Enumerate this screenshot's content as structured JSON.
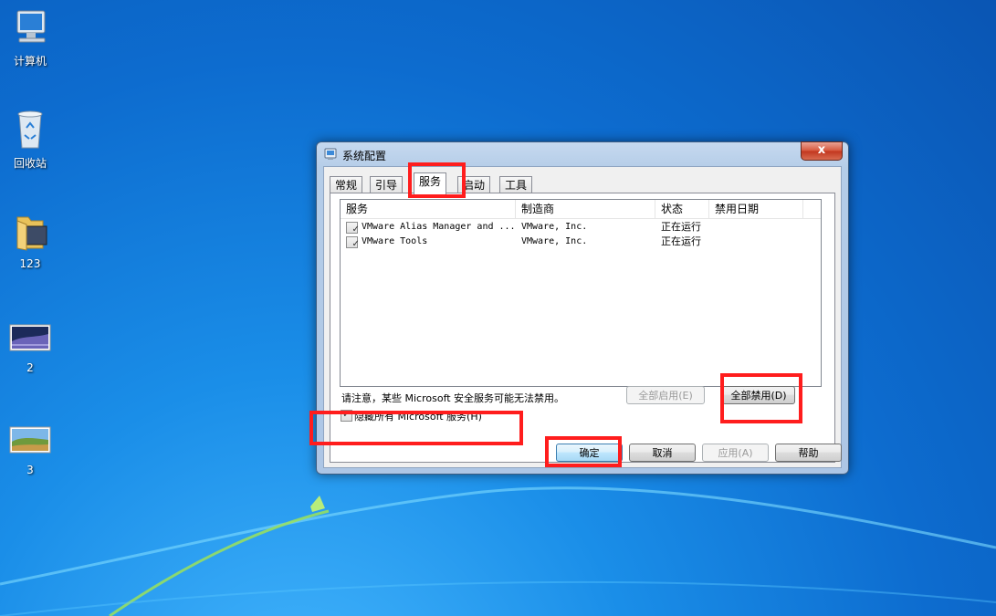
{
  "desktop": {
    "icons": [
      {
        "label": "计算机"
      },
      {
        "label": "回收站"
      },
      {
        "label": "123"
      },
      {
        "label": "2"
      },
      {
        "label": "3"
      }
    ]
  },
  "window": {
    "title": "系统配置",
    "close_glyph": "x",
    "tabs": [
      {
        "label": "常规"
      },
      {
        "label": "引导"
      },
      {
        "label": "服务"
      },
      {
        "label": "启动"
      },
      {
        "label": "工具"
      }
    ],
    "active_tab": "服务",
    "list": {
      "columns": [
        "服务",
        "制造商",
        "状态",
        "禁用日期"
      ],
      "rows": [
        {
          "checked": true,
          "service": "VMware Alias Manager and ...",
          "vendor": "VMware, Inc.",
          "status": "正在运行",
          "disabled_date": ""
        },
        {
          "checked": true,
          "service": "VMware Tools",
          "vendor": "VMware, Inc.",
          "status": "正在运行",
          "disabled_date": ""
        }
      ]
    },
    "note": "请注意，某些 Microsoft 安全服务可能无法禁用。",
    "enable_all_label": "全部启用(E)",
    "disable_all_label": "全部禁用(D)",
    "hide_ms_checked": true,
    "hide_ms_label": "隐藏所有 Microsoft 服务(H)",
    "buttons": {
      "ok": "确定",
      "cancel": "取消",
      "apply": "应用(A)",
      "help": "帮助"
    },
    "check_glyph": "✓"
  },
  "colors": {
    "highlight_box": "#ff1d1d",
    "desktop_blue": "#0d6ccf"
  }
}
